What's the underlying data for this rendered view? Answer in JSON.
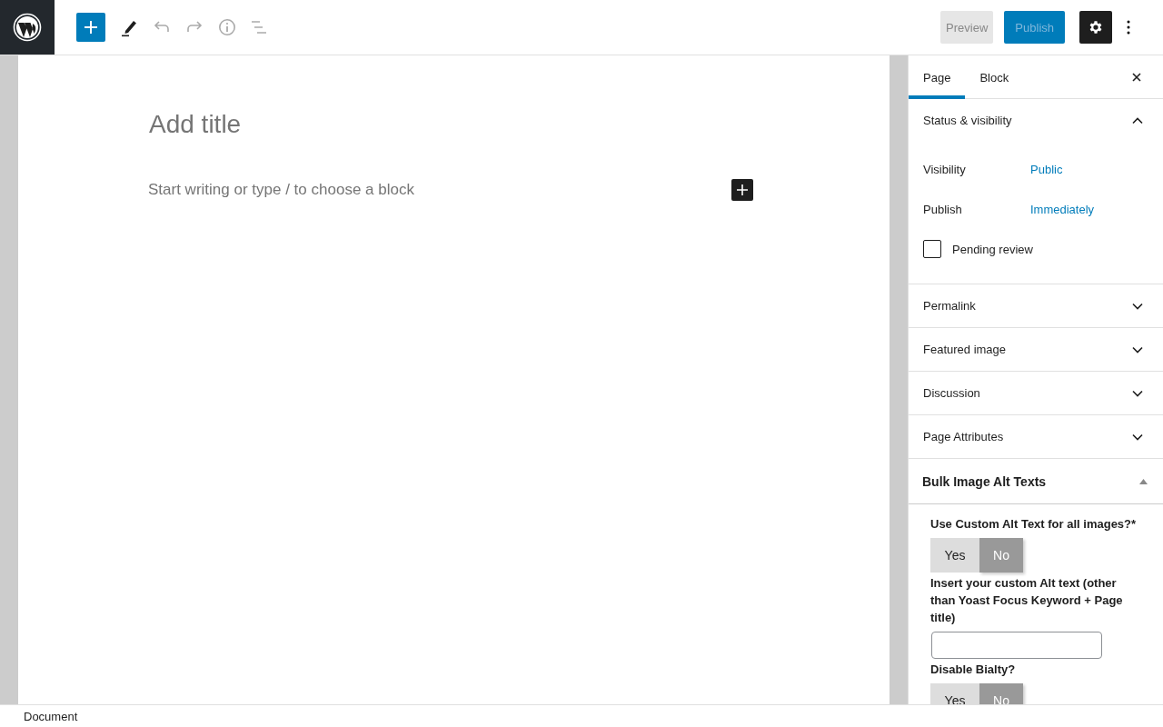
{
  "toolbar": {
    "buttons": [
      {
        "kind": "preview",
        "label": "Preview"
      },
      {
        "kind": "publish",
        "label": "Publish"
      }
    ]
  },
  "editor": {
    "title": {
      "placeholder": "Add title"
    },
    "body": {
      "placeholder": "Start writing or type / to choose a block"
    }
  },
  "sidebar": {
    "tabs": [
      {
        "label": "Page",
        "selected": true
      },
      {
        "label": "Block",
        "selected": false
      }
    ],
    "panels": [
      {
        "kind": "status",
        "title": "Status & visibility",
        "expanded": true,
        "rows": [
          {
            "label": "Visibility",
            "value": "Public"
          },
          {
            "label": "Publish",
            "value": "Immediately"
          }
        ],
        "checkbox": {
          "label": "Pending review",
          "checked": false
        }
      },
      {
        "kind": "plain",
        "title": "Permalink",
        "expanded": false
      },
      {
        "kind": "plain",
        "title": "Featured image",
        "expanded": false
      },
      {
        "kind": "plain",
        "title": "Discussion",
        "expanded": false
      },
      {
        "kind": "plain",
        "title": "Page Attributes",
        "expanded": false
      },
      {
        "kind": "metabox",
        "title": "Bulk Image Alt Texts",
        "expanded": true,
        "fields": [
          {
            "kind": "toggle",
            "label": "Use Custom Alt Text for all images?*",
            "options": [
              {
                "label": "Yes",
                "selected": false
              },
              {
                "label": "No",
                "selected": true
              }
            ]
          },
          {
            "kind": "text",
            "label": "Insert your custom Alt text (other than Yoast Focus Keyword + Page title)"
          },
          {
            "kind": "toggle",
            "label": "Disable Bialty?",
            "options": [
              {
                "label": "Yes",
                "selected": false
              },
              {
                "label": "No",
                "selected": true
              }
            ]
          }
        ]
      }
    ]
  },
  "status_bar": {
    "label": "Document"
  }
}
